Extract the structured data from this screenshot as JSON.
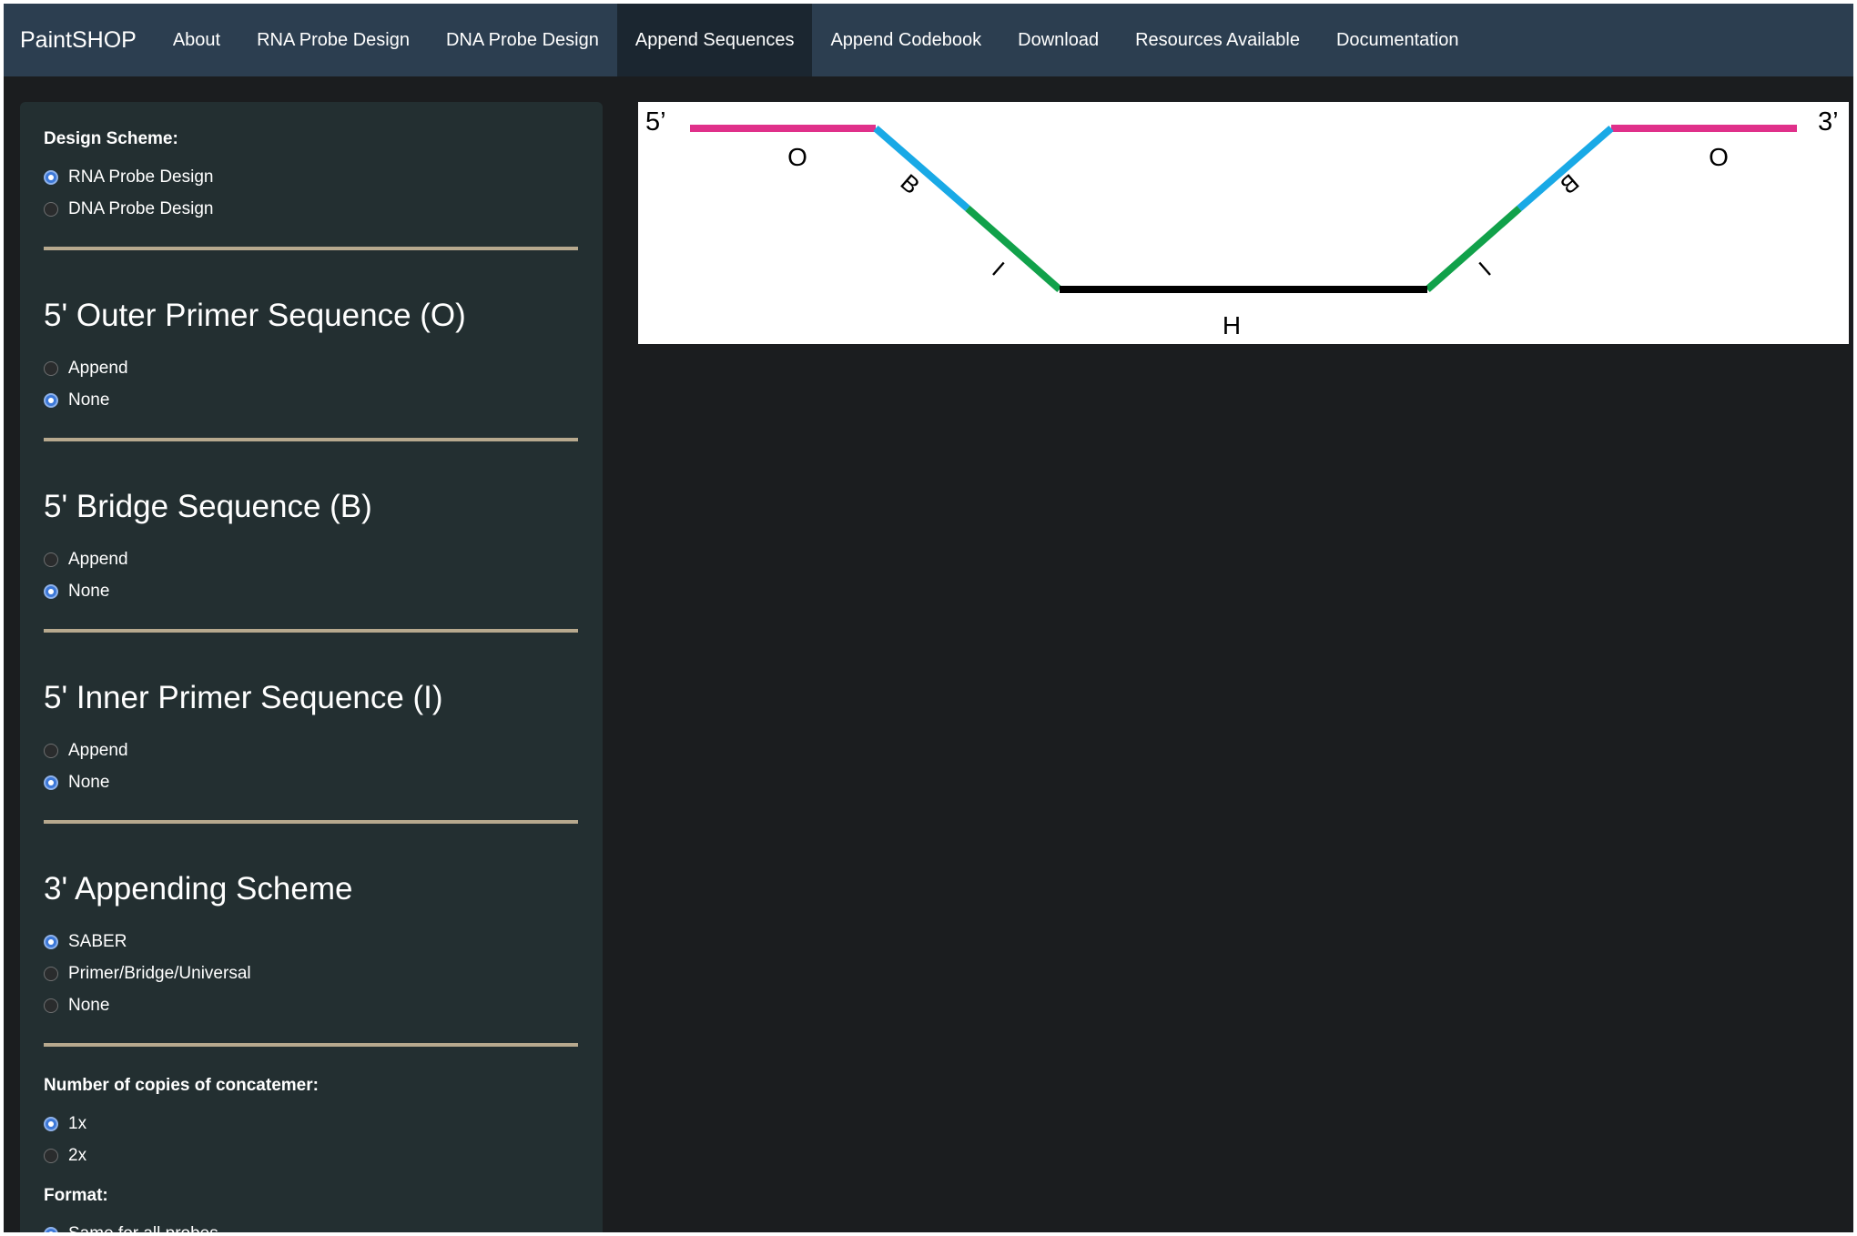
{
  "navbar": {
    "brand": "PaintSHOP",
    "items": [
      {
        "label": "About",
        "active": false
      },
      {
        "label": "RNA Probe Design",
        "active": false
      },
      {
        "label": "DNA Probe Design",
        "active": false
      },
      {
        "label": "Append Sequences",
        "active": true
      },
      {
        "label": "Append Codebook",
        "active": false
      },
      {
        "label": "Download",
        "active": false
      },
      {
        "label": "Resources Available",
        "active": false
      },
      {
        "label": "Documentation",
        "active": false
      }
    ]
  },
  "sidebar": {
    "design_scheme": {
      "label": "Design Scheme:",
      "options": [
        "RNA Probe Design",
        "DNA Probe Design"
      ],
      "selected": "RNA Probe Design"
    },
    "outer_primer": {
      "title": "5' Outer Primer Sequence (O)",
      "options": [
        "Append",
        "None"
      ],
      "selected": "None"
    },
    "bridge": {
      "title": "5' Bridge Sequence (B)",
      "options": [
        "Append",
        "None"
      ],
      "selected": "None"
    },
    "inner_primer": {
      "title": "5' Inner Primer Sequence (I)",
      "options": [
        "Append",
        "None"
      ],
      "selected": "None"
    },
    "appending_scheme": {
      "title": "3' Appending Scheme",
      "options": [
        "SABER",
        "Primer/Bridge/Universal",
        "None"
      ],
      "selected": "SABER"
    },
    "copies": {
      "label": "Number of copies of concatemer:",
      "options": [
        "1x",
        "2x"
      ],
      "selected": "1x"
    },
    "format": {
      "label": "Format:",
      "options": [
        "Same for all probes"
      ],
      "selected": "Same for all probes"
    }
  },
  "diagram": {
    "five_prime": "5’",
    "three_prime": "3’",
    "segments": {
      "outer": "O",
      "bridge": "B",
      "inner": "I",
      "homology": "H"
    },
    "colors": {
      "outer": "#e0308a",
      "bridge": "#19a9e6",
      "inner": "#11a14a",
      "homology": "#000000"
    }
  }
}
